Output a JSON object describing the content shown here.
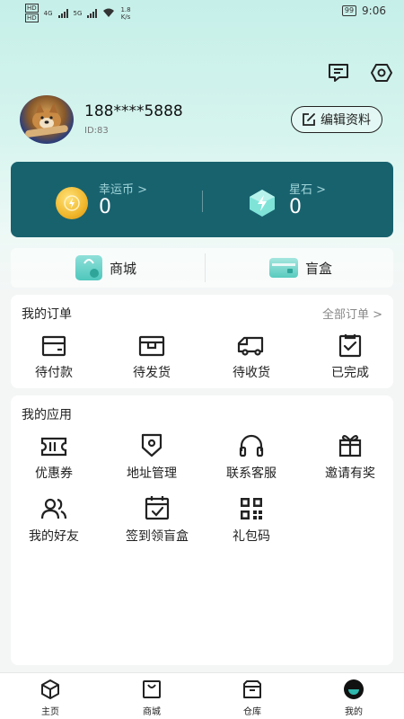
{
  "status_bar": {
    "sim1": "HD",
    "sim2": "HD",
    "net1": "4G",
    "net2": "5G",
    "speed_value": "1.8",
    "speed_unit": "K/s",
    "battery": "99",
    "time": "9:06"
  },
  "header_icons": [
    "message-icon",
    "settings-icon"
  ],
  "profile": {
    "phone": "188****5888",
    "user_id": "ID:83",
    "edit_label": "编辑资料"
  },
  "wallet": {
    "coin_label": "幸运币 >",
    "coin_value": "0",
    "stone_label": "星石 >",
    "stone_value": "0"
  },
  "shop": {
    "mall_label": "商城",
    "blindbox_label": "盲盒"
  },
  "orders": {
    "title": "我的订单",
    "all_label": "全部订单 >",
    "items": [
      {
        "label": "待付款",
        "icon": "wallet-card-icon"
      },
      {
        "label": "待发货",
        "icon": "package-icon"
      },
      {
        "label": "待收货",
        "icon": "truck-icon"
      },
      {
        "label": "已完成",
        "icon": "clipboard-check-icon"
      }
    ]
  },
  "apps": {
    "title": "我的应用",
    "items": [
      {
        "label": "优惠券",
        "icon": "coupon-icon"
      },
      {
        "label": "地址管理",
        "icon": "location-icon"
      },
      {
        "label": "联系客服",
        "icon": "headset-icon"
      },
      {
        "label": "邀请有奖",
        "icon": "gift-icon"
      },
      {
        "label": "我的好友",
        "icon": "friends-icon"
      },
      {
        "label": "签到领盲盒",
        "icon": "calendar-check-icon"
      },
      {
        "label": "礼包码",
        "icon": "qrcode-icon"
      }
    ]
  },
  "tabbar": {
    "items": [
      {
        "label": "主页",
        "icon": "cube-icon"
      },
      {
        "label": "商城",
        "icon": "bag-icon"
      },
      {
        "label": "仓库",
        "icon": "warehouse-box-icon"
      },
      {
        "label": "我的",
        "icon": "user-face-icon"
      }
    ],
    "active_index": 3
  },
  "colors": {
    "wallet_bg": "#18626e",
    "accent": "#4fc7bc"
  }
}
